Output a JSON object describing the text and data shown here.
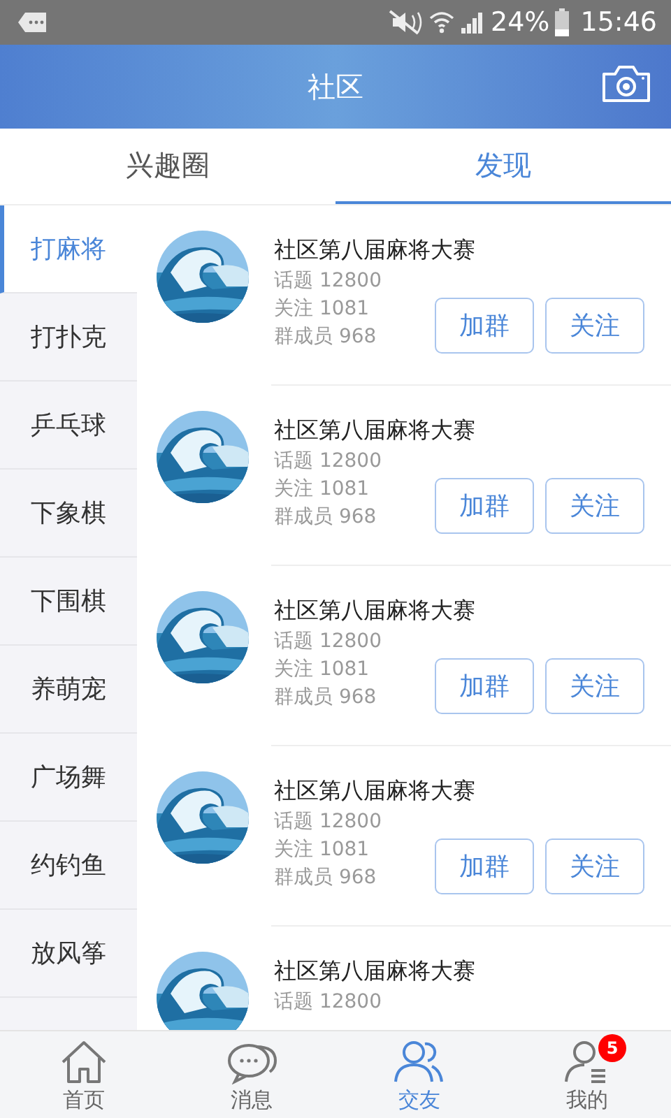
{
  "status_bar": {
    "battery": "24%",
    "time": "15:46"
  },
  "header": {
    "title": "社区"
  },
  "tabs": [
    {
      "label": "兴趣圈",
      "selected": false
    },
    {
      "label": "发现",
      "selected": true
    }
  ],
  "sidebar": {
    "items": [
      {
        "label": "打麻将",
        "selected": true
      },
      {
        "label": "打扑克",
        "selected": false
      },
      {
        "label": "乒乓球",
        "selected": false
      },
      {
        "label": "下象棋",
        "selected": false
      },
      {
        "label": "下围棋",
        "selected": false
      },
      {
        "label": "养萌宠",
        "selected": false
      },
      {
        "label": "广场舞",
        "selected": false
      },
      {
        "label": "约钓鱼",
        "selected": false
      },
      {
        "label": "放风筝",
        "selected": false
      }
    ]
  },
  "groups": [
    {
      "title": "社区第八届麻将大赛",
      "topics": "话题 12800",
      "follows": "关注 1081",
      "members": "群成员 968",
      "buttons": [
        "加群",
        "关注"
      ]
    },
    {
      "title": "社区第八届麻将大赛",
      "topics": "话题 12800",
      "follows": "关注 1081",
      "members": "群成员 968",
      "buttons": [
        "加群",
        "关注"
      ]
    },
    {
      "title": "社区第八届麻将大赛",
      "topics": "话题 12800",
      "follows": "关注 1081",
      "members": "群成员 968",
      "buttons": [
        "加群",
        "关注"
      ]
    },
    {
      "title": "社区第八届麻将大赛",
      "topics": "话题 12800",
      "follows": "关注 1081",
      "members": "群成员 968",
      "buttons": [
        "加群",
        "关注"
      ]
    },
    {
      "title": "社区第八届麻将大赛",
      "topics": "话题 12800"
    }
  ],
  "bottom_nav": [
    {
      "kind": "home",
      "label": "首页",
      "selected": false
    },
    {
      "kind": "messages",
      "label": "消息",
      "selected": false
    },
    {
      "kind": "friends",
      "label": "交友",
      "selected": true
    },
    {
      "kind": "me",
      "label": "我的",
      "selected": false,
      "badge": "5"
    }
  ]
}
